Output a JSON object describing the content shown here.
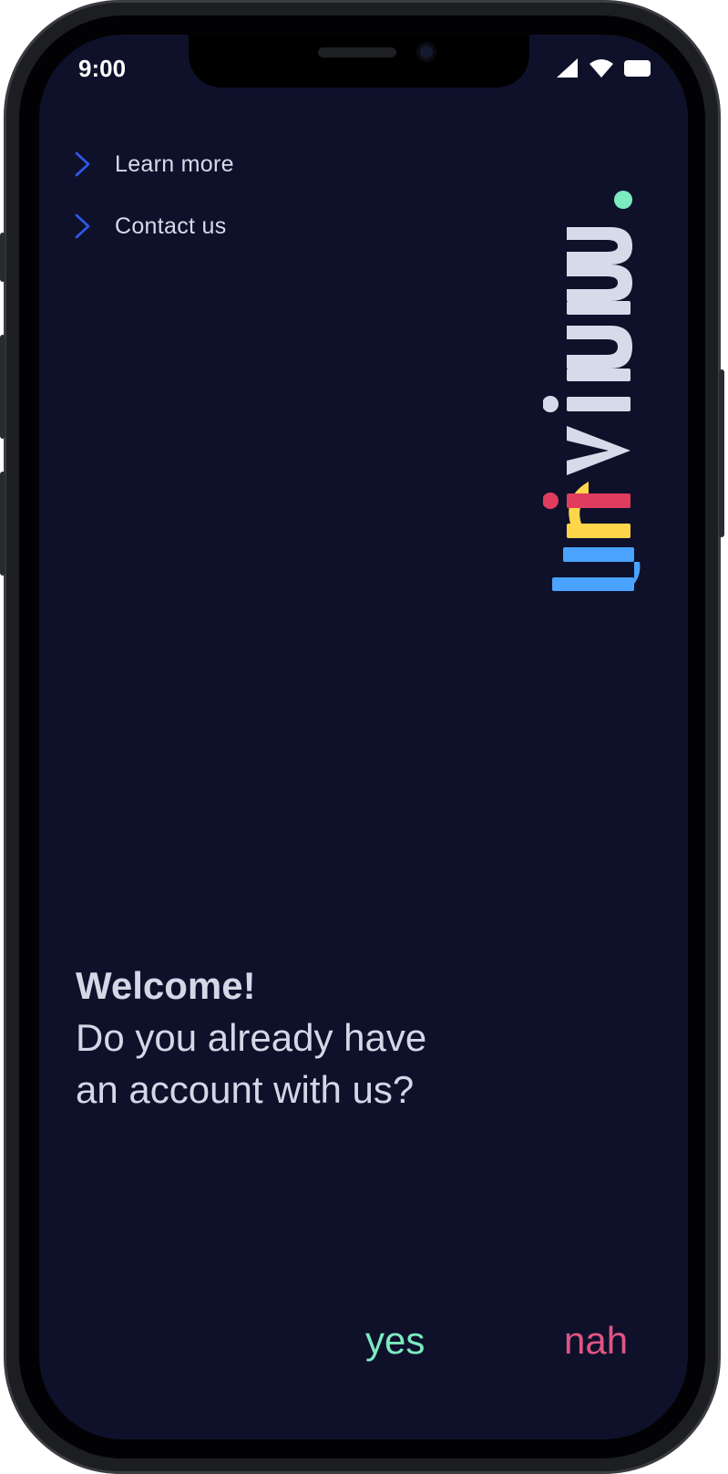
{
  "status_bar": {
    "time": "9:00",
    "icons": [
      "cellular-signal-icon",
      "wifi-icon",
      "battery-icon"
    ]
  },
  "menu": {
    "items": [
      {
        "label": "Learn more",
        "icon": "chevron-right-icon"
      },
      {
        "label": "Contact us",
        "icon": "chevron-right-icon"
      }
    ]
  },
  "brand": {
    "name": "trivium",
    "letters": [
      {
        "char": "t",
        "color": "#4aa3ff"
      },
      {
        "char": "r",
        "color": "#ffd54a"
      },
      {
        "char": "i",
        "color": "#e03c5e"
      },
      {
        "char": "v",
        "color": "#d7dbe9"
      },
      {
        "char": "i",
        "color": "#d7dbe9"
      },
      {
        "char": "u",
        "color": "#d7dbe9"
      },
      {
        "char": "m",
        "color": "#d7dbe9"
      }
    ],
    "dot_color": "#7beac0"
  },
  "welcome": {
    "title": "Welcome!",
    "question": "Do you already have an account with us?"
  },
  "actions": {
    "yes_label": "yes",
    "no_label": "nah"
  },
  "colors": {
    "background": "#0f112b",
    "accent_blue": "#2f5bea",
    "yes": "#7beac0",
    "no": "#e05584",
    "text": "#d7dbe9"
  }
}
